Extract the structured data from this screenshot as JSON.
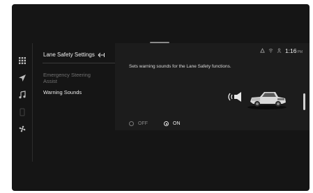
{
  "menu": {
    "title": "Lane Safety Settings",
    "items": [
      {
        "label_line1": "Emergency Steering",
        "label_line2": "Assist",
        "state": "disabled"
      },
      {
        "label_line1": "Warning Sounds",
        "state": "selected"
      }
    ]
  },
  "status_bar": {
    "time": "1:16",
    "ampm": "PM"
  },
  "content": {
    "description": "Sets warning sounds for the Lane Safety functions.",
    "options": [
      {
        "label": "OFF",
        "selected": false
      },
      {
        "label": "ON",
        "selected": true
      }
    ]
  },
  "icons": {
    "sidebar": [
      "apps-grid-icon",
      "navigation-arrow-icon",
      "music-note-icon",
      "phone-icon",
      "fan-icon"
    ],
    "status": [
      "signal-icon",
      "wifi-icon",
      "user-icon"
    ],
    "illustration": [
      "warning-speaker-icon",
      "pickup-truck-image"
    ]
  },
  "colors": {
    "background": "#151515",
    "content_bg": "#1c1c1c",
    "text_primary": "#f0f0f0",
    "text_dim": "#707070"
  }
}
